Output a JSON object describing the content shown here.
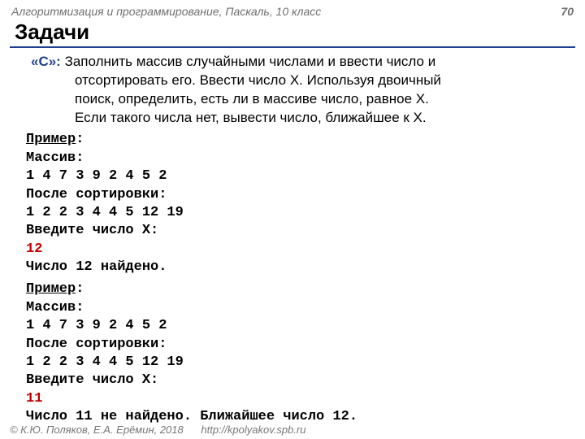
{
  "header": {
    "course": "Алгоритмизация и программирование, Паскаль, 10 класс",
    "page": "70"
  },
  "title": "Задачи",
  "task": {
    "label": "«С»:",
    "line1": " Заполнить массив случайными числами и ввести число и",
    "line2": "отсортировать его.  Ввести число X. Используя двоичный",
    "line3": "поиск, определить, есть ли в массиве число, равное X.",
    "line4": "Если такого числа нет, вывести число, ближайшее к X."
  },
  "example1": {
    "header": "Пример",
    "colon": ":",
    "l1": "Массив:",
    "l2": "1 4 7 3 9 2 4 5 2",
    "l3": "После сортировки:",
    "l4": "1 2 2 3 4 4 5 12 19",
    "l5": "Введите число X:",
    "l6": "12",
    "l7": "Число 12 найдено."
  },
  "example2": {
    "header": "Пример",
    "colon": ":",
    "l1": "Массив:",
    "l2": "1 4 7 3 9 2 4 5 2",
    "l3": "После сортировки:",
    "l4": "1 2 2 3 4 4 5 12 19",
    "l5": "Введите число X:",
    "l6": "11",
    "l7": "Число 11 не найдено. Ближайшее число 12."
  },
  "footer": {
    "copyright": "© К.Ю. Поляков, Е.А. Ерёмин, 2018",
    "url": "http://kpolyakov.spb.ru"
  }
}
